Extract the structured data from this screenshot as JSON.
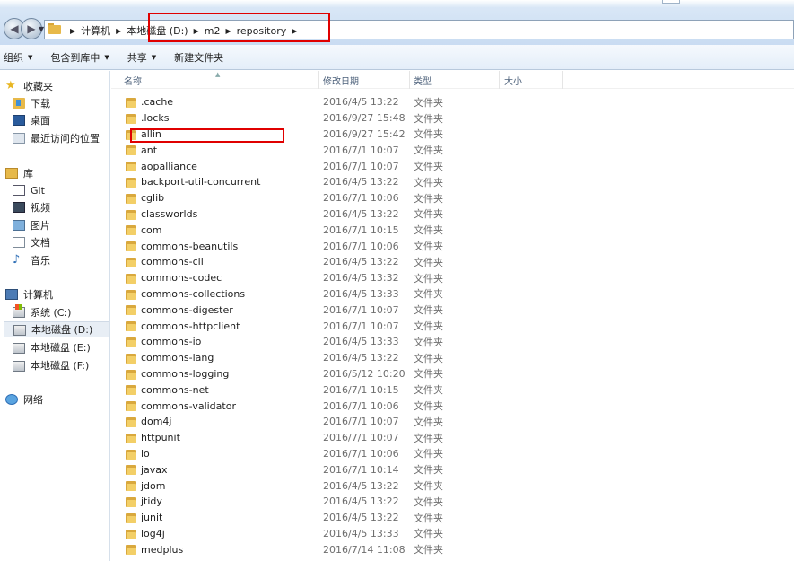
{
  "address_bar": {
    "crumbs": [
      "计算机",
      "本地磁盘 (D:)",
      "m2",
      "repository"
    ]
  },
  "toolbar": {
    "organize": "组织",
    "include_in_library": "包含到库中",
    "share": "共享",
    "new_folder": "新建文件夹"
  },
  "sidebar": {
    "favorites": "收藏夹",
    "downloads": "下载",
    "desktop": "桌面",
    "recent_places": "最近访问的位置",
    "libraries": "库",
    "git": "Git",
    "videos": "视频",
    "pictures": "图片",
    "documents": "文档",
    "music": "音乐",
    "computer": "计算机",
    "drive_c": "系统 (C:)",
    "drive_d": "本地磁盘 (D:)",
    "drive_e": "本地磁盘 (E:)",
    "drive_f": "本地磁盘 (F:)",
    "network": "网络"
  },
  "columns": {
    "name": "名称",
    "date_modified": "修改日期",
    "type": "类型",
    "size": "大小"
  },
  "files": [
    {
      "name": ".cache",
      "date": "2016/4/5 13:22",
      "type": "文件夹"
    },
    {
      "name": ".locks",
      "date": "2016/9/27 15:48",
      "type": "文件夹"
    },
    {
      "name": "allin",
      "date": "2016/9/27 15:42",
      "type": "文件夹"
    },
    {
      "name": "ant",
      "date": "2016/7/1 10:07",
      "type": "文件夹"
    },
    {
      "name": "aopalliance",
      "date": "2016/7/1 10:07",
      "type": "文件夹"
    },
    {
      "name": "backport-util-concurrent",
      "date": "2016/4/5 13:22",
      "type": "文件夹"
    },
    {
      "name": "cglib",
      "date": "2016/7/1 10:06",
      "type": "文件夹"
    },
    {
      "name": "classworlds",
      "date": "2016/4/5 13:22",
      "type": "文件夹"
    },
    {
      "name": "com",
      "date": "2016/7/1 10:15",
      "type": "文件夹"
    },
    {
      "name": "commons-beanutils",
      "date": "2016/7/1 10:06",
      "type": "文件夹"
    },
    {
      "name": "commons-cli",
      "date": "2016/4/5 13:22",
      "type": "文件夹"
    },
    {
      "name": "commons-codec",
      "date": "2016/4/5 13:32",
      "type": "文件夹"
    },
    {
      "name": "commons-collections",
      "date": "2016/4/5 13:33",
      "type": "文件夹"
    },
    {
      "name": "commons-digester",
      "date": "2016/7/1 10:07",
      "type": "文件夹"
    },
    {
      "name": "commons-httpclient",
      "date": "2016/7/1 10:07",
      "type": "文件夹"
    },
    {
      "name": "commons-io",
      "date": "2016/4/5 13:33",
      "type": "文件夹"
    },
    {
      "name": "commons-lang",
      "date": "2016/4/5 13:22",
      "type": "文件夹"
    },
    {
      "name": "commons-logging",
      "date": "2016/5/12 10:20",
      "type": "文件夹"
    },
    {
      "name": "commons-net",
      "date": "2016/7/1 10:15",
      "type": "文件夹"
    },
    {
      "name": "commons-validator",
      "date": "2016/7/1 10:06",
      "type": "文件夹"
    },
    {
      "name": "dom4j",
      "date": "2016/7/1 10:07",
      "type": "文件夹"
    },
    {
      "name": "httpunit",
      "date": "2016/7/1 10:07",
      "type": "文件夹"
    },
    {
      "name": "io",
      "date": "2016/7/1 10:06",
      "type": "文件夹"
    },
    {
      "name": "javax",
      "date": "2016/7/1 10:14",
      "type": "文件夹"
    },
    {
      "name": "jdom",
      "date": "2016/4/5 13:22",
      "type": "文件夹"
    },
    {
      "name": "jtidy",
      "date": "2016/4/5 13:22",
      "type": "文件夹"
    },
    {
      "name": "junit",
      "date": "2016/4/5 13:22",
      "type": "文件夹"
    },
    {
      "name": "log4j",
      "date": "2016/4/5 13:33",
      "type": "文件夹"
    },
    {
      "name": "medplus",
      "date": "2016/7/14 11:08",
      "type": "文件夹"
    }
  ],
  "colors": {
    "annotation_red": "#e00000",
    "folder_yellow": "#f3cf67"
  }
}
